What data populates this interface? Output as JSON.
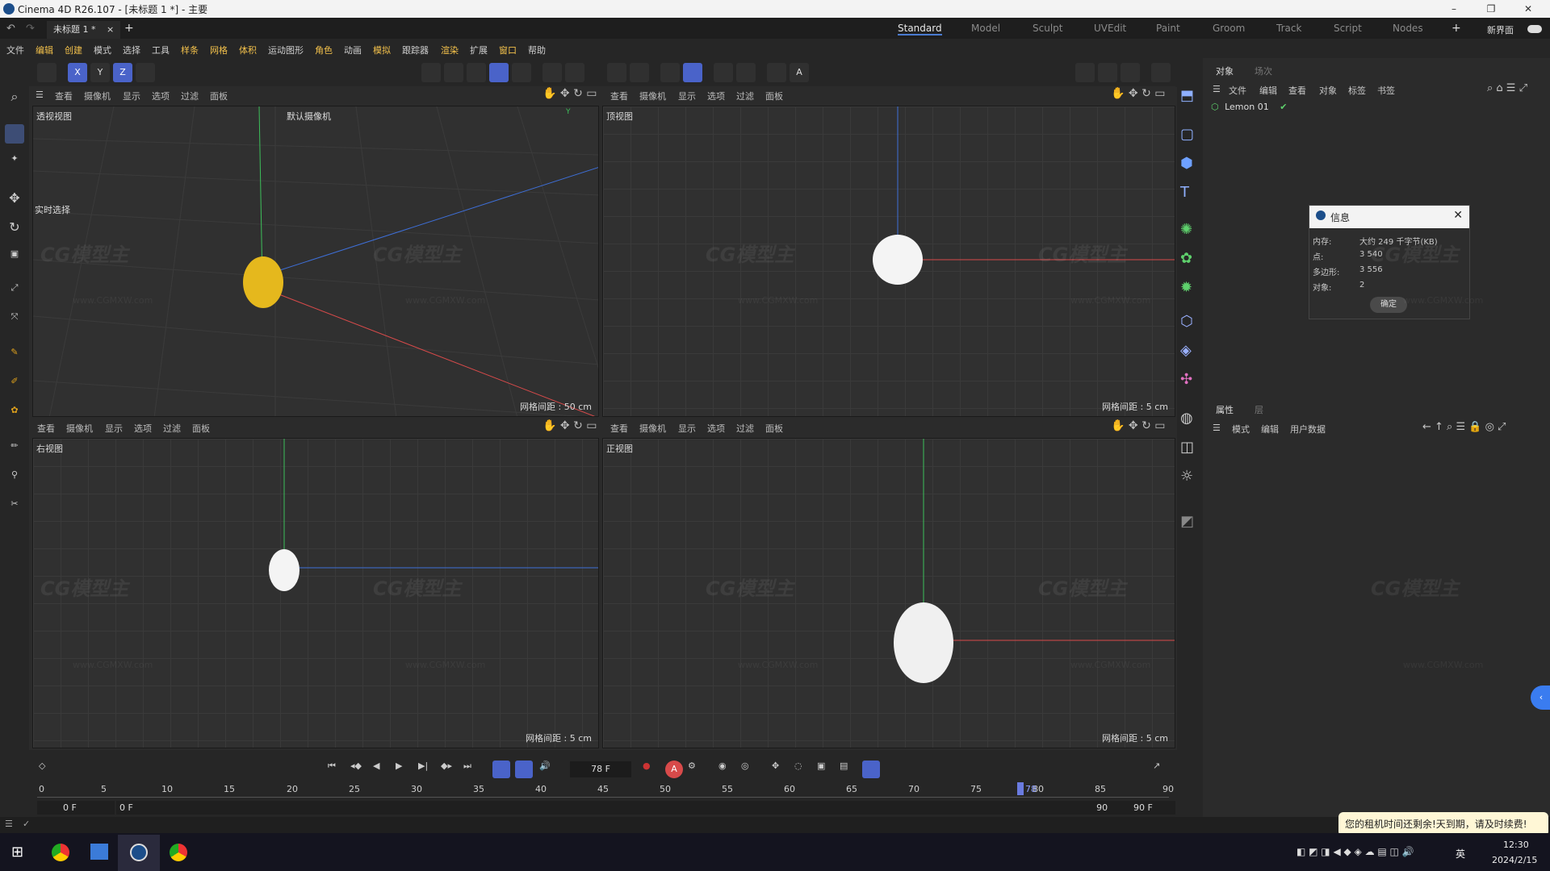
{
  "titlebar": {
    "title": "Cinema 4D R26.107 - [未标题 1 *] - 主要"
  },
  "doc_tab": "未标题 1 *",
  "layouts": [
    "Standard",
    "Model",
    "Sculpt",
    "UVEdit",
    "Paint",
    "Groom",
    "Track",
    "Script",
    "Nodes"
  ],
  "new_layout": "新界面",
  "menus": [
    "文件",
    "编辑",
    "创建",
    "模式",
    "选择",
    "工具",
    "样条",
    "网格",
    "体积",
    "运动图形",
    "角色",
    "动画",
    "模拟",
    "跟踪器",
    "渲染",
    "扩展",
    "窗口",
    "帮助"
  ],
  "viewport_menus": [
    "查看",
    "摄像机",
    "显示",
    "选项",
    "过滤",
    "面板"
  ],
  "viewports": [
    {
      "label": "透视视图",
      "grid": "网格间距 : 50 cm",
      "camera": "默认摄像机"
    },
    {
      "label": "顶视图",
      "grid": "网格间距 : 5 cm"
    },
    {
      "label": "右视图",
      "grid": "网格间距 : 5 cm"
    },
    {
      "label": "正视图",
      "grid": "网格间距 : 5 cm"
    }
  ],
  "realtime_select": "实时选择",
  "objects_panel": {
    "tabs": [
      "对象",
      "场次"
    ],
    "menus": [
      "文件",
      "编辑",
      "查看",
      "对象",
      "标签",
      "书签"
    ],
    "items": [
      "Lemon 01"
    ]
  },
  "attributes_panel": {
    "tabs": [
      "属性",
      "层"
    ],
    "menus": [
      "模式",
      "编辑",
      "用户数据"
    ]
  },
  "info_dialog": {
    "title": "信息",
    "rows": [
      {
        "label": "内存:",
        "value": "大约 249 千字节(KB)"
      },
      {
        "label": "点:",
        "value": "3 540"
      },
      {
        "label": "多边形:",
        "value": "3 556"
      },
      {
        "label": "对象:",
        "value": "2"
      }
    ],
    "ok": "确定"
  },
  "timeline": {
    "current_frame": "78 F",
    "ticks": [
      "0",
      "5",
      "10",
      "15",
      "20",
      "25",
      "30",
      "35",
      "40",
      "45",
      "50",
      "55",
      "60",
      "65",
      "70",
      "75",
      "80",
      "85",
      "90"
    ],
    "playhead": "78",
    "range_start": "0 F",
    "range_inner_start": "0 F",
    "range_inner_end": "90 F",
    "range_end": "90 F"
  },
  "toast": "您的租机时间还剩余!天到期，请及时续费!",
  "tray": {
    "time": "12:30",
    "date": "2024/2/15",
    "lang": "英"
  },
  "watermark": "CG模型主",
  "watermark_url": "www.CGMXW.com",
  "colors": {
    "accent": "#4a63c9",
    "axis_x": "#d84a4a",
    "axis_y": "#3dbf5a",
    "axis_z": "#3e6fd8",
    "lemon": "#e5b81d"
  }
}
